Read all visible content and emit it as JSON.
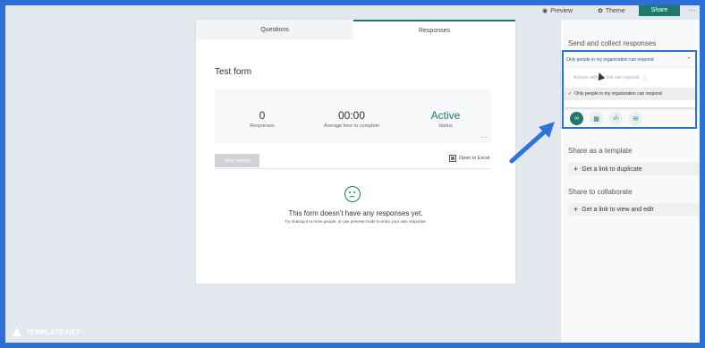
{
  "topbar": {
    "preview_label": "Preview",
    "theme_label": "Theme",
    "share_label": "Share",
    "more_label": "···"
  },
  "tabs": {
    "questions": "Questions",
    "responses": "Responses"
  },
  "form": {
    "title": "Test form",
    "stats": [
      {
        "value": "0",
        "label": "Responses"
      },
      {
        "value": "00:00",
        "label": "Average time to complete"
      },
      {
        "value": "Active",
        "label": "Status"
      }
    ],
    "stats_more": "···",
    "view_results_label": "View results",
    "open_excel_label": "Open in Excel",
    "empty_title": "This form doesn't have any responses yet.",
    "empty_subtitle": "Try sharing it to more people, or use preview mode to enter your own response."
  },
  "panel": {
    "send_collect_heading": "Send and collect responses",
    "audience_selected": "Only people in my organization can respond",
    "audience_options": [
      "Anyone with the link can respond",
      "Only people in my organization can respond"
    ],
    "template_heading": "Share as a template",
    "duplicate_link_label": "Get a link to duplicate",
    "collaborate_heading": "Share to collaborate",
    "view_edit_link_label": "Get a link to view and edit"
  },
  "watermark": "TEMPLATE.NET",
  "colors": {
    "frame_border": "#2d6fd6",
    "accent": "#1f7a6b",
    "highlight": "#2d74da"
  }
}
